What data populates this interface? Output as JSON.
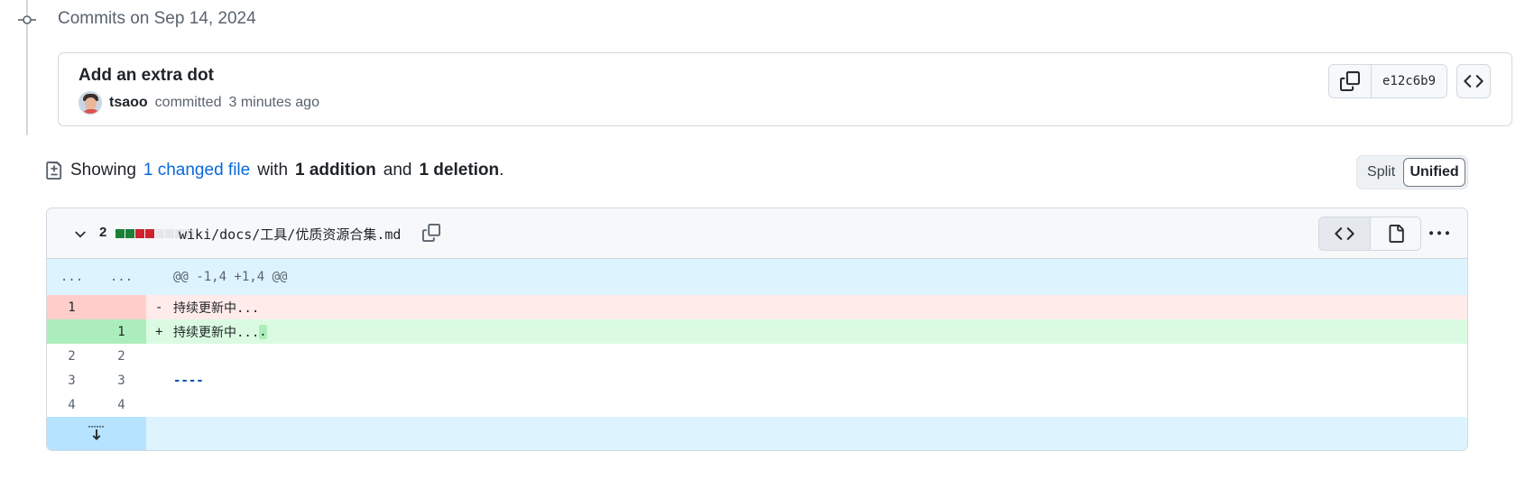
{
  "timeline": {
    "group_title": "Commits on Sep 14, 2024"
  },
  "commit": {
    "title": "Add an extra dot",
    "author": "tsaoo",
    "action": "committed",
    "time": "3 minutes ago",
    "sha": "e12c6b9"
  },
  "summary": {
    "prefix": "Showing",
    "changed_files": "1 changed file",
    "with": "with",
    "additions": "1 addition",
    "and": "and",
    "deletions": "1 deletion",
    "suffix": "."
  },
  "view_toggle": {
    "split": "Split",
    "unified": "Unified",
    "selected": "Unified"
  },
  "file": {
    "change_count": "2",
    "path": "wiki/docs/工具/优质资源合集.md",
    "diffstat": [
      "add",
      "add",
      "del",
      "del",
      "neutral",
      "neutral",
      "neutral",
      "neutral"
    ]
  },
  "diff": {
    "hunk": {
      "left": "...",
      "right": "...",
      "header": "@@ -1,4 +1,4 @@"
    },
    "deleted": {
      "old": "1",
      "new": "",
      "sign": "-",
      "text": "持续更新中..."
    },
    "added": {
      "old": "",
      "new": "1",
      "sign": "+",
      "text": "持续更新中...",
      "highlight": "."
    },
    "context": [
      {
        "old": "2",
        "new": "2",
        "text": ""
      },
      {
        "old": "3",
        "new": "3",
        "text": "----"
      },
      {
        "old": "4",
        "new": "4",
        "text": ""
      }
    ]
  },
  "colors": {
    "link": "#0969da",
    "addition": "#1a7f37",
    "deletion": "#cf222e",
    "hunk_bg": "#ddf4ff"
  },
  "icons": [
    "git-commit-icon",
    "copy-icon",
    "code-icon",
    "file-diff-icon",
    "chevron-down-icon",
    "file-icon",
    "kebab-horizontal-icon",
    "unfold-icon"
  ]
}
